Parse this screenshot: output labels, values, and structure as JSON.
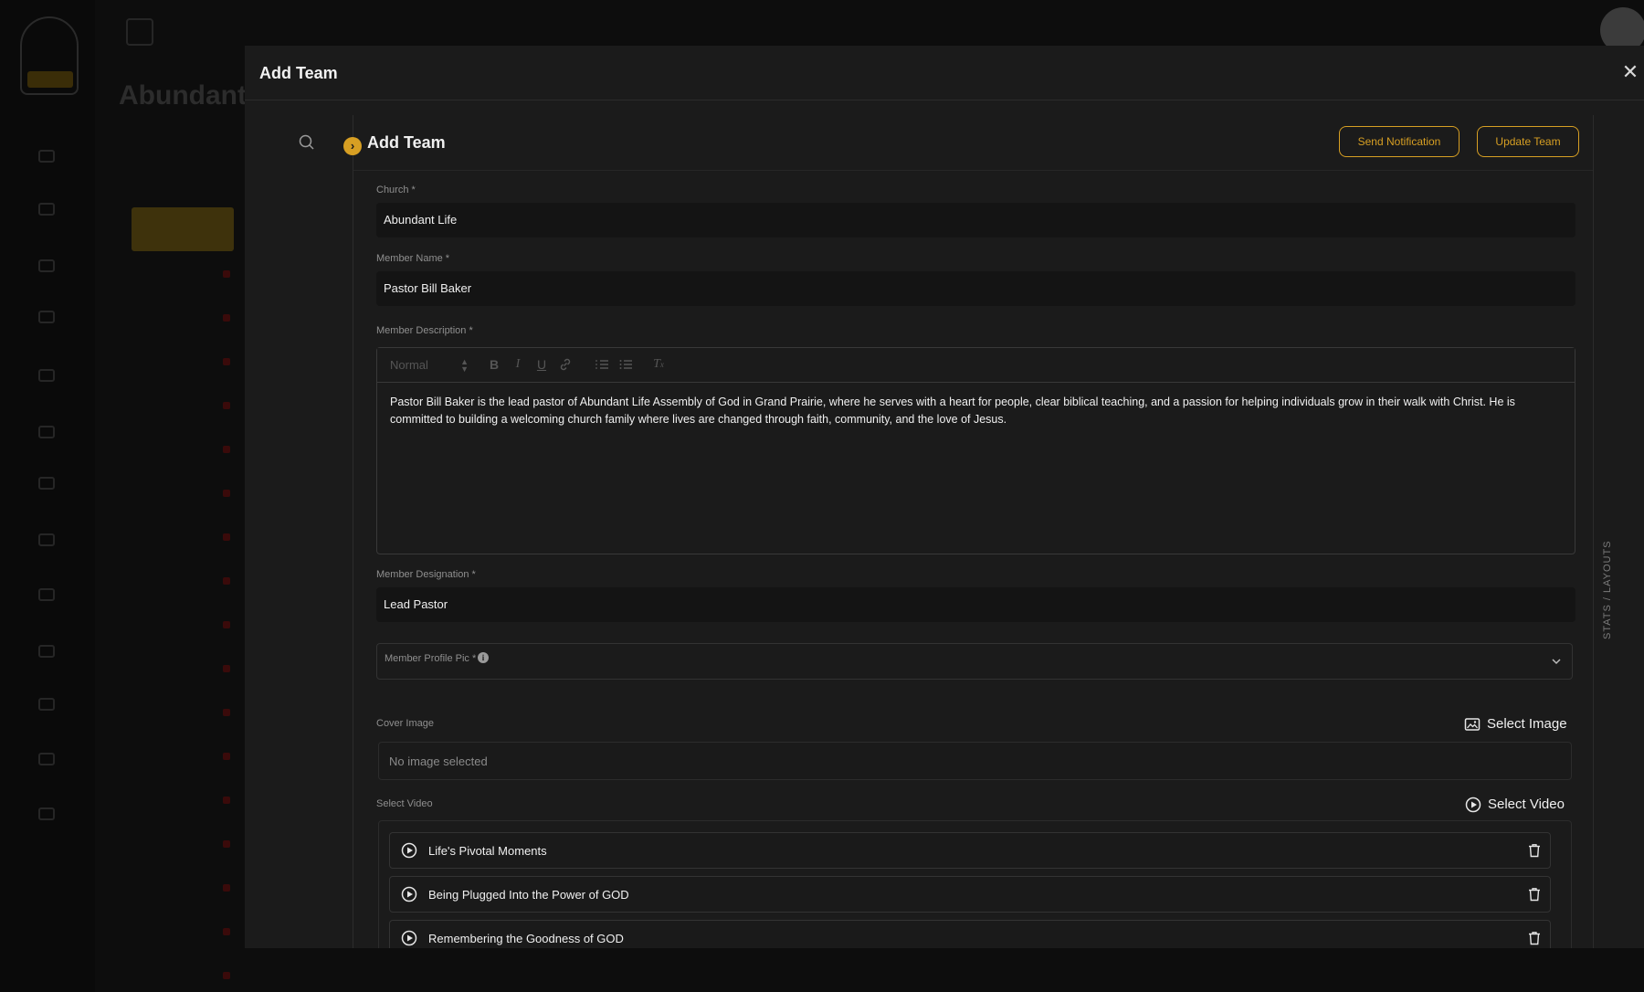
{
  "background": {
    "page_title": "Abundant L"
  },
  "modal": {
    "title": "Add Team",
    "close_glyph": "✕",
    "section_title": "Add Team",
    "side_label": "STATS / LAYOUTS",
    "buttons": {
      "send_notification": "Send Notification",
      "update_team": "Update Team"
    },
    "fields": {
      "church": {
        "label": "Church *",
        "value": "Abundant Life"
      },
      "member_name": {
        "label": "Member Name *",
        "value": "Pastor Bill Baker"
      },
      "member_description": {
        "label": "Member Description *",
        "toolbar_format": "Normal",
        "value": "Pastor Bill Baker is the lead pastor of Abundant Life Assembly of God in Grand Prairie, where he serves with a heart for people, clear biblical teaching, and a passion for helping individuals grow in their walk with Christ. He is committed to building a welcoming church family where lives are changed through faith, community, and the love of Jesus."
      },
      "member_designation": {
        "label": "Member Designation *",
        "value": "Lead Pastor"
      },
      "member_profile_pic": {
        "label": "Member Profile Pic *"
      },
      "cover_image": {
        "label": "Cover Image",
        "action": "Select Image",
        "placeholder": "No image selected"
      },
      "select_video": {
        "label": "Select Video",
        "action": "Select Video"
      }
    },
    "videos": [
      {
        "title": "Life's Pivotal Moments"
      },
      {
        "title": "Being Plugged Into the Power of GOD"
      },
      {
        "title": "Remembering the Goodness of GOD"
      }
    ]
  },
  "colors": {
    "accent": "#d79f23",
    "modal_bg": "#1b1b1b",
    "field_bg": "#141414"
  },
  "icons": {
    "close": "close-icon",
    "search": "search-icon",
    "toggle": "chevron-right-icon",
    "info": "info-icon",
    "dropdown": "chevron-down-icon",
    "image": "image-icon",
    "play": "play-circle-icon",
    "trash": "trash-icon"
  }
}
